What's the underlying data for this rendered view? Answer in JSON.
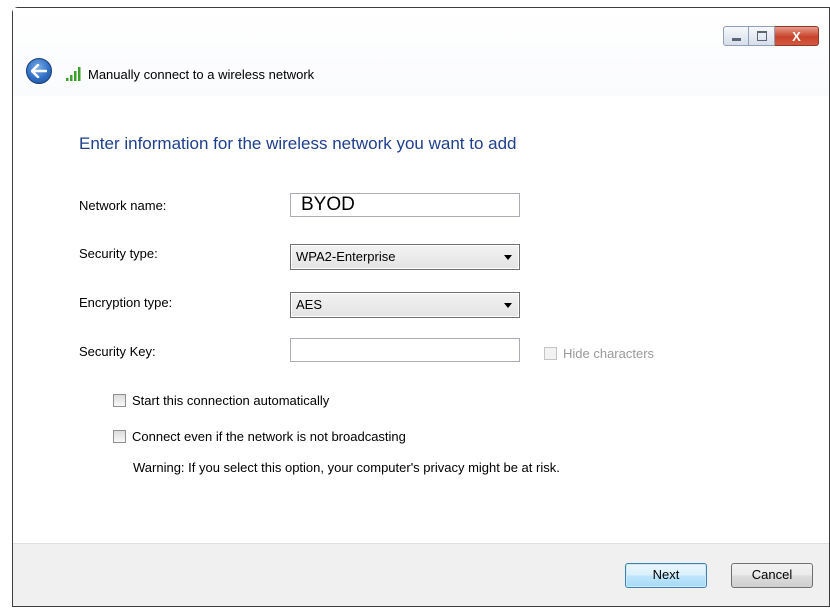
{
  "window": {
    "title": "Manually connect to a wireless network",
    "caption_close_glyph": "X"
  },
  "heading": "Enter information for the wireless network you want to add",
  "form": {
    "network_name_label": "Network name:",
    "network_name_value": "BYOD",
    "security_type_label": "Security type:",
    "security_type_value": "WPA2-Enterprise",
    "encryption_type_label": "Encryption type:",
    "encryption_type_value": "AES",
    "security_key_label": "Security Key:",
    "security_key_value": "",
    "hide_characters_label": "Hide characters",
    "hide_characters_checked": false
  },
  "options": {
    "start_auto_label": "Start this connection automatically",
    "start_auto_checked": false,
    "connect_hidden_label": "Connect even if the network is not broadcasting",
    "connect_hidden_checked": false,
    "warning_text": "Warning: If you select this option, your computer's privacy might be at risk."
  },
  "buttons": {
    "next_label": "Next",
    "cancel_label": "Cancel"
  },
  "icons": {
    "back": "back-arrow-icon",
    "signal": "wireless-signal-icon",
    "minimize": "minimize-icon",
    "maximize": "maximize-icon",
    "close": "close-icon"
  },
  "colors": {
    "heading": "#1e3f8c",
    "close_button": "#c7432c",
    "signal_green": "#3aa12a"
  }
}
